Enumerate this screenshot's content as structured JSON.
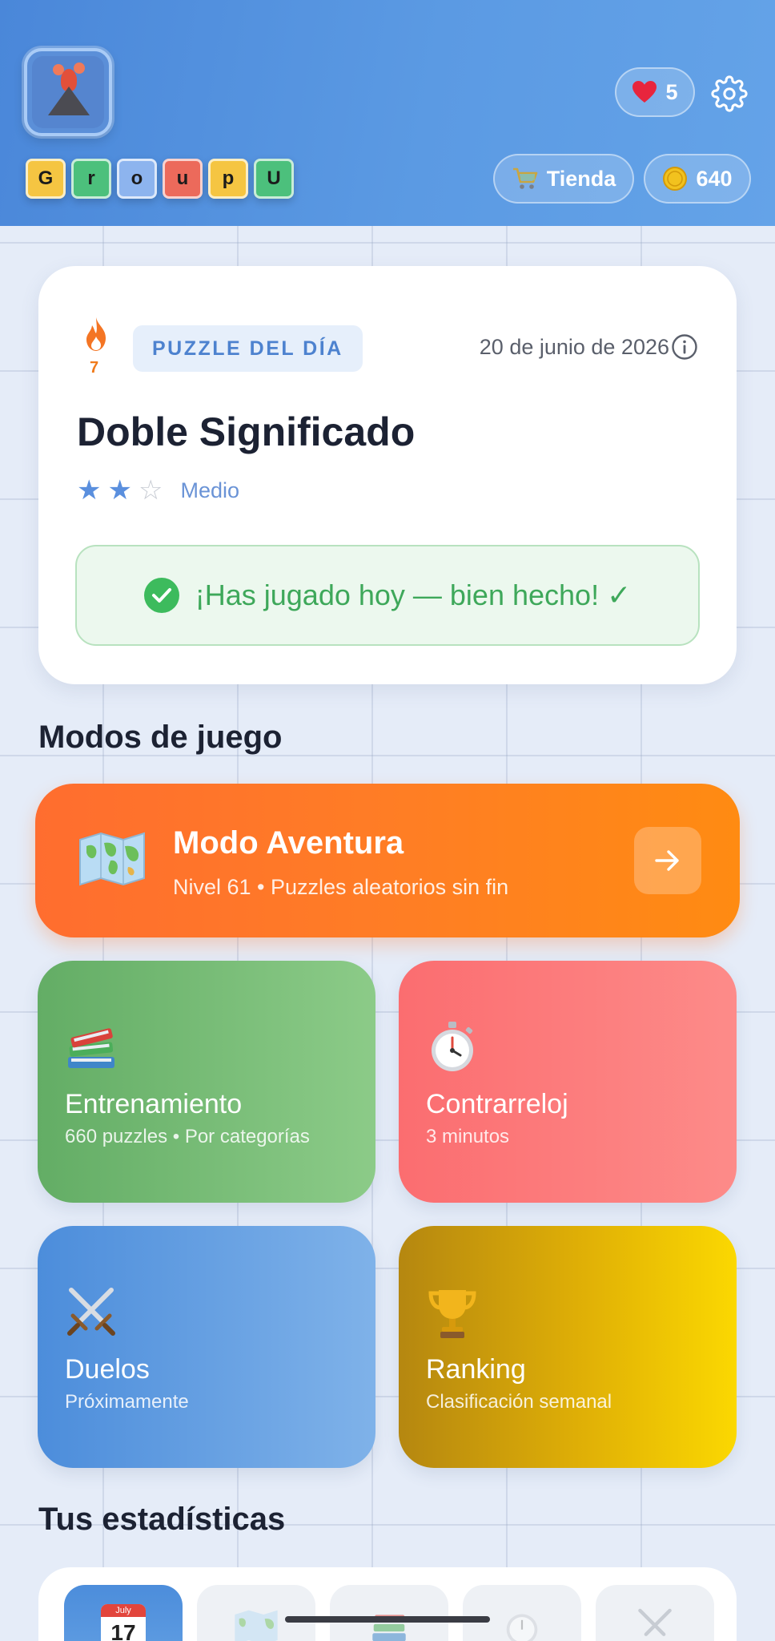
{
  "header": {
    "logo_tiles": [
      {
        "letter": "G",
        "color": "#f5c542"
      },
      {
        "letter": "r",
        "color": "#4cc07c"
      },
      {
        "letter": "o",
        "color": "#8db4ee"
      },
      {
        "letter": "u",
        "color": "#ec6a5b"
      },
      {
        "letter": "p",
        "color": "#f5c542"
      },
      {
        "letter": "U",
        "color": "#4cc07c"
      }
    ],
    "lives": "5",
    "shop_label": "Tienda",
    "coins": "640"
  },
  "daily": {
    "streak": "7",
    "badge": "PUZZLE DEL DÍA",
    "date": "20 de junio de 2026",
    "title": "Doble Significado",
    "stars_filled": 2,
    "stars_total": 3,
    "difficulty": "Medio",
    "played_message": "¡Has jugado hoy — bien hecho! ✓"
  },
  "modes_section_title": "Modos de juego",
  "adventure": {
    "title": "Modo Aventura",
    "subtitle": "Nivel 61 • Puzzles aleatorios sin fin"
  },
  "modes": [
    {
      "id": "training",
      "title": "Entrenamiento",
      "subtitle": "660 puzzles • Por categorías",
      "icon": "books-icon"
    },
    {
      "id": "timeattack",
      "title": "Contrarreloj",
      "subtitle": "3 minutos",
      "icon": "stopwatch-icon"
    },
    {
      "id": "duels",
      "title": "Duelos",
      "subtitle": "Próximamente",
      "icon": "crossed-swords-icon"
    },
    {
      "id": "ranking",
      "title": "Ranking",
      "subtitle": "Clasificación semanal",
      "icon": "trophy-icon"
    }
  ],
  "stats_section_title": "Tus estadísticas",
  "stats_tabs": [
    {
      "icon": "calendar-icon",
      "calendar_month": "July",
      "calendar_day": "17",
      "active": true
    },
    {
      "icon": "map-icon",
      "active": false
    },
    {
      "icon": "books-icon",
      "active": false
    },
    {
      "icon": "stopwatch-icon",
      "active": false
    },
    {
      "icon": "crossed-swords-icon",
      "active": false
    }
  ],
  "colors": {
    "header": "#4a87d9",
    "accent_blue": "#4d82cf",
    "success_green": "#3ea85a",
    "adventure_orange": "#ff7d25",
    "training_green": "#6db56e",
    "timeattack_red": "#fb7677",
    "duels_blue": "#5c9be2",
    "ranking_gold": "#d9ab07"
  }
}
